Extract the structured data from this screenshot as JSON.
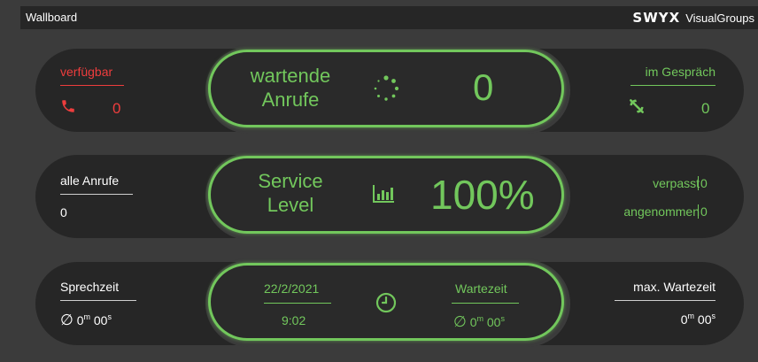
{
  "topbar": {
    "title": "Wallboard",
    "logo": "SWYX",
    "product": "VisualGroups"
  },
  "row1": {
    "left": {
      "label": "verfügbar",
      "value": "0",
      "icon": "phone-icon"
    },
    "center": {
      "label_line1": "wartende",
      "label_line2": "Anrufe",
      "value": "0",
      "icon": "spinner-icon"
    },
    "right": {
      "label": "im Gespräch",
      "value": "0",
      "icon": "headset-icon"
    }
  },
  "row2": {
    "left": {
      "label": "alle Anrufe",
      "value": "0"
    },
    "center": {
      "label_line1": "Service",
      "label_line2": "Level",
      "value": "100%",
      "icon": "bar-chart-icon"
    },
    "right": {
      "missed_label": "verpasst",
      "missed_value": "0",
      "accepted_label": "angenommen",
      "accepted_value": "0"
    }
  },
  "row3": {
    "left": {
      "label": "Sprechzeit",
      "avg_symbol": "∅",
      "minutes": "0",
      "min_unit": "m",
      "seconds": "00",
      "sec_unit": "s"
    },
    "center": {
      "date": "22/2/2021",
      "time": "9:02",
      "icon": "clock-icon",
      "wait_label": "Wartezeit",
      "avg_symbol": "∅",
      "minutes": "0",
      "min_unit": "m",
      "seconds": "00",
      "sec_unit": "s"
    },
    "right": {
      "label": "max. Wartezeit",
      "minutes": "0",
      "min_unit": "m",
      "seconds": "00",
      "sec_unit": "s"
    }
  },
  "colors": {
    "accent": "#72c75c",
    "alert": "#ee3d3d",
    "panel": "#262626",
    "background": "#3b3b3b"
  }
}
